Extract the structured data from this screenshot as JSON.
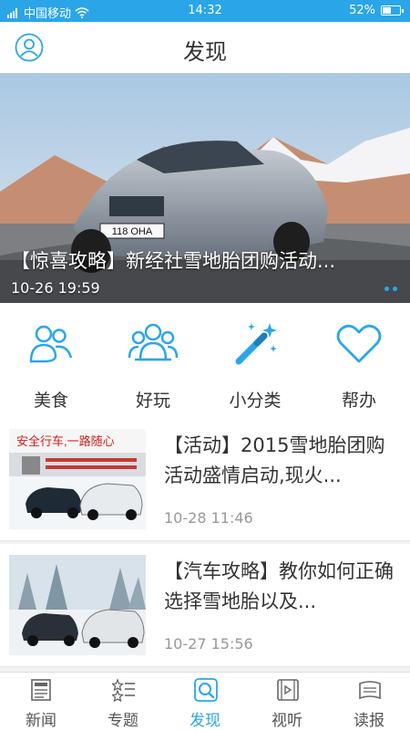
{
  "status_bar": {
    "carrier": "中国移动",
    "time": "14:32",
    "battery": "52%",
    "battery_level": 0.52
  },
  "header": {
    "title": "发现"
  },
  "banner": {
    "caption": "【惊喜攻略】新经社雪地胎团购活动...",
    "time": "10-26 19:59",
    "plate_text": "118 OHA"
  },
  "categories": [
    {
      "label": "美食",
      "icon": "people-icon"
    },
    {
      "label": "好玩",
      "icon": "group-icon"
    },
    {
      "label": "小分类",
      "icon": "magic-wand-icon"
    },
    {
      "label": "帮办",
      "icon": "heart-icon"
    }
  ],
  "articles": [
    {
      "title": "【活动】2015雪地胎团购活动盛情启动,现火...",
      "time": "10-28 11:46",
      "thumb_text": "安全行车,一路随心"
    },
    {
      "title": "【汽车攻略】教你如何正确选择雪地胎以及...",
      "time": "10-27 15:56"
    }
  ],
  "tabs": [
    {
      "label": "新闻",
      "icon": "news-icon",
      "active": false
    },
    {
      "label": "专题",
      "icon": "topics-icon",
      "active": false
    },
    {
      "label": "发现",
      "icon": "discover-icon",
      "active": true
    },
    {
      "label": "视听",
      "icon": "media-icon",
      "active": false
    },
    {
      "label": "读报",
      "icon": "newspaper-icon",
      "active": false
    }
  ],
  "colors": {
    "accent": "#2aa6e8",
    "text": "#333333",
    "muted": "#999999"
  }
}
